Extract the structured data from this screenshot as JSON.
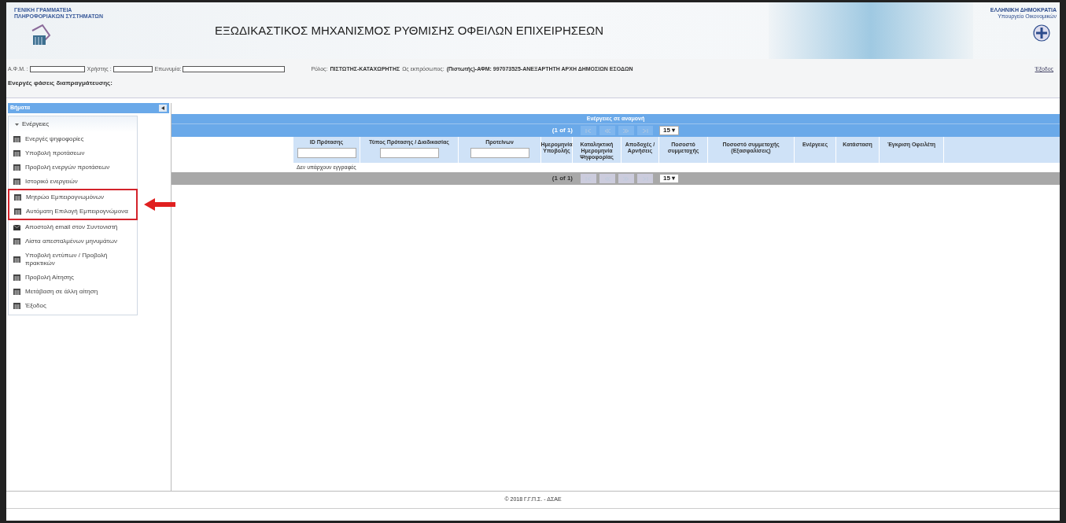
{
  "header": {
    "agency_lines": [
      "ΓΕΝΙΚΗ ΓΡΑΜΜΑΤΕΙΑ",
      "ΠΛΗΡΟΦΟΡΙΑΚΩΝ ΣΥΣΤΗΜΑΤΩΝ"
    ],
    "title": "ΕΞΩΔΙΚΑΣΤΙΚΟΣ ΜΗΧΑΝΙΣΜΟΣ ΡΥΘΜΙΣΗΣ ΟΦΕΙΛΩΝ ΕΠΙΧΕΙΡΗΣΕΩΝ",
    "country": "ΕΛΛΗΝΙΚΗ ΔΗΜΟΚΡΑΤΙΑ",
    "ministry": "Υπουργείο Οικονομικών"
  },
  "info_bar": {
    "fields": [
      {
        "label": "Α.Φ.Μ. :"
      },
      {
        "label": "Χρήστης :"
      },
      {
        "label": "Επωνυμία:"
      }
    ],
    "role_label": "Ρόλος:",
    "role": "ΠΙΣΤΩΤΗΣ-ΚΑΤΑΧΩΡΗΤΗΣ",
    "representing_label": "Ως εκπρόσωπος:",
    "representing": "(Πιστωτής)-ΑΦΜ: 997073525-ΑΝΕΞΑΡΤΗΤΗ ΑΡΧΗ ΔΗΜΟΣΙΩΝ ΕΣΟΔΩΝ",
    "logout": "Έξοδος",
    "phases": "Ενεργές φάσεις διαπραγμάτευσης:"
  },
  "sidebar": {
    "title": "Βήματα",
    "group": {
      "label": "Ενέργειες",
      "expanded": true,
      "items": [
        {
          "label": "Ενεργές ψηφοφορίες",
          "kind": "table",
          "highlighted": false
        },
        {
          "label": "Υποβολή προτάσεων",
          "kind": "table",
          "highlighted": false
        },
        {
          "label": "Προβολή ενεργών προτάσεων",
          "kind": "table",
          "highlighted": false
        },
        {
          "label": "Ιστορικό ενεργειών",
          "kind": "table",
          "highlighted": false
        },
        {
          "label": "Μητρώο Εμπειρογνωμόνων",
          "kind": "table",
          "highlighted": true
        },
        {
          "label": "Αυτόματη Επιλογή Εμπειρογνώμονα",
          "kind": "table",
          "highlighted": true
        },
        {
          "label": "Αποστολή email στον Συντονιστή",
          "kind": "mail",
          "highlighted": false
        },
        {
          "label": "Λίστα απεσταλμένων μηνυμάτων",
          "kind": "table",
          "highlighted": false
        },
        {
          "label": "Υποβολή εντύπων / Προβολή πρακτικών",
          "kind": "table",
          "highlighted": false
        },
        {
          "label": "Προβολή Αίτησης",
          "kind": "table",
          "highlighted": false
        },
        {
          "label": "Μετάβαση σε άλλη αίτηση",
          "kind": "table",
          "highlighted": false
        },
        {
          "label": "Έξοδος",
          "kind": "table",
          "highlighted": false
        }
      ]
    }
  },
  "table": {
    "title": "Ενέργειες σε αναμονή",
    "top_paginator": {
      "page": "(1 of 1)",
      "rows_per_page": "15 ▾"
    },
    "bottom_paginator": {
      "page": "(1 of 1)",
      "rows_per_page": "15 ▾"
    },
    "columns": [
      {
        "label": "ID Πρότασης",
        "filter": true
      },
      {
        "label": "Τύπος Πρότασης / Διαδικασίας",
        "filter": true
      },
      {
        "label": "Προτείνων",
        "filter": true
      },
      {
        "label": "Ημερομηνία Υποβολής",
        "filter": false
      },
      {
        "label": "Καταληκτική Ημερομηνία Ψηφοφορίας",
        "filter": false
      },
      {
        "label": "Αποδοχές / Αρνήσεις",
        "filter": false
      },
      {
        "label": "Ποσοστό συμμετοχής",
        "filter": false
      },
      {
        "label": "Ποσοστό συμμετοχής (Εξασφαλίσεις)",
        "filter": false
      },
      {
        "label": "Ενέργειες",
        "filter": false
      },
      {
        "label": "Κατάσταση",
        "filter": false
      },
      {
        "label": "Έγκριση Οφειλέτη",
        "filter": false
      }
    ],
    "empty_message": "Δεν υπάρχουν εγγραφές"
  },
  "footer": "© 2018 Γ.Γ.Π.Σ. - ΔΣΑΕ"
}
